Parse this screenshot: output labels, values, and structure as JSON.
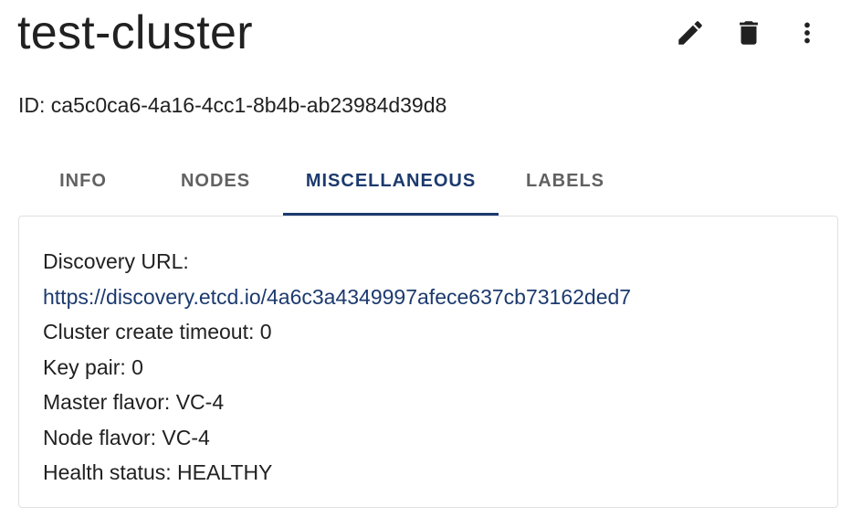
{
  "header": {
    "title": "test-cluster",
    "id_text": "ID: ca5c0ca6-4a16-4cc1-8b4b-ab23984d39d8",
    "actions": [
      {
        "name": "edit",
        "icon": "pencil-icon"
      },
      {
        "name": "delete",
        "icon": "trash-icon"
      },
      {
        "name": "more",
        "icon": "more-vert-icon"
      }
    ]
  },
  "tabs": [
    {
      "label": "INFO",
      "active": false
    },
    {
      "label": "NODES",
      "active": false
    },
    {
      "label": "MISCELLANEOUS",
      "active": true
    },
    {
      "label": "LABELS",
      "active": false
    }
  ],
  "details": {
    "discovery_url_label": "Discovery URL:",
    "discovery_url": "https://discovery.etcd.io/4a6c3a4349997afece637cb73162ded7",
    "create_timeout": "Cluster create timeout: 0",
    "key_pair": "Key pair: 0",
    "master_flavor": "Master flavor: VC-4",
    "node_flavor": "Node flavor: VC-4",
    "health_status": "Health status: HEALTHY"
  },
  "colors": {
    "accent": "#1c3a6e",
    "text": "#212121",
    "tab_inactive": "#616161"
  }
}
